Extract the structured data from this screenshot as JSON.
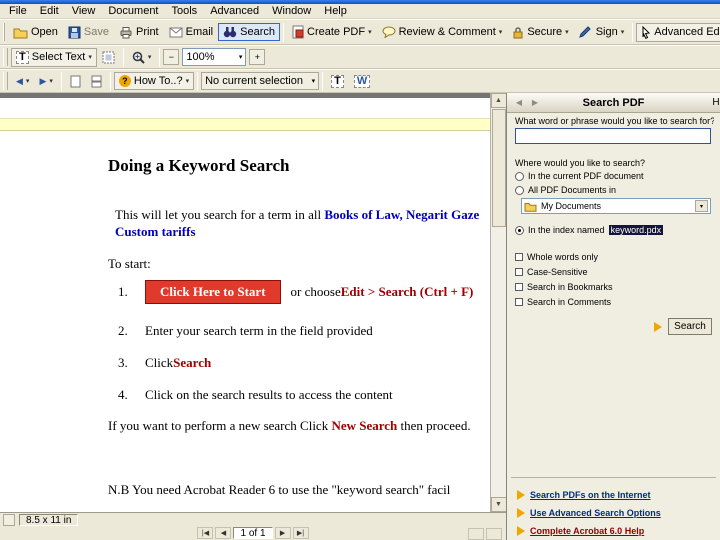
{
  "menubar": {
    "items": [
      "File",
      "Edit",
      "View",
      "Document",
      "Tools",
      "Advanced",
      "Window",
      "Help"
    ]
  },
  "toolbar_main": {
    "open": "Open",
    "save": "Save",
    "print": "Print",
    "email": "Email",
    "search": "Search",
    "create_pdf": "Create PDF",
    "review_comment": "Review & Comment",
    "secure": "Secure",
    "sign": "Sign",
    "advanced_editing": "Advanced Editing"
  },
  "toolbar_zoom": {
    "select_text": "Select Text",
    "zoom_level": "100%"
  },
  "toolbar_howto": {
    "how_to": "How To..?",
    "selection_status": "No current selection"
  },
  "document": {
    "title": "Doing a Keyword Search",
    "intro_text": "This will let you search for a term in all ",
    "intro_link_line1": "Books of Law, Negarit Gaze",
    "intro_link_line2": "Custom tariffs",
    "to_start": "To start:",
    "step1_number": "1.",
    "step1_button": "Click Here to Start",
    "step1_connector": "or  choose ",
    "step1_shortcut": "Edit > Search (Ctrl + F)",
    "step2_number": "2.",
    "step2_text": "Enter your search term in the field provided",
    "step3_number": "3.",
    "step3_text": "Click ",
    "step3_keyword": "Search",
    "step4_number": "4.",
    "step4_text": "Click on the search results to access the content",
    "new_search_pre": "If you want to perform a new search Click ",
    "new_search_keyword": "New Search",
    "new_search_post": " then proceed.",
    "note": "N.B You need Acrobat Reader 6 to use the \"keyword search\" facil"
  },
  "search_panel": {
    "title": "Search PDF",
    "hide_button": "Hide",
    "question1": "What word or phrase would you like to search for?",
    "search_term": "",
    "question2": "Where would you like to search?",
    "option_current": "In the current PDF document",
    "option_all": "All PDF Documents in",
    "location_value": "My Documents",
    "option_index_prefix": "In the index named",
    "option_index_name": "keyword.pdx",
    "check_whole_words": "Whole words only",
    "check_case": "Case-Sensitive",
    "check_bookmarks": "Search in Bookmarks",
    "check_comments": "Search in Comments",
    "search_button": "Search",
    "links": [
      "Search PDFs on the Internet",
      "Use Advanced Search Options",
      "Complete Acrobat 6.0 Help"
    ]
  },
  "statusbar": {
    "page_size": "8.5 x 11 in",
    "page_indicator": "1 of 1"
  },
  "icons": {
    "dropdown_caret": "▾",
    "scroll_up": "▲",
    "scroll_down": "▼",
    "back_arrow": "◀",
    "forward_arrow": "▶",
    "nav_first": "|◀",
    "nav_prev": "◀",
    "nav_next": "▶",
    "nav_last": "▶|",
    "zoom_out": "−",
    "zoom_in": "+",
    "question_mark": "?",
    "select_text_letter": "T",
    "touchup_letter": "T",
    "word_letter": "W"
  }
}
